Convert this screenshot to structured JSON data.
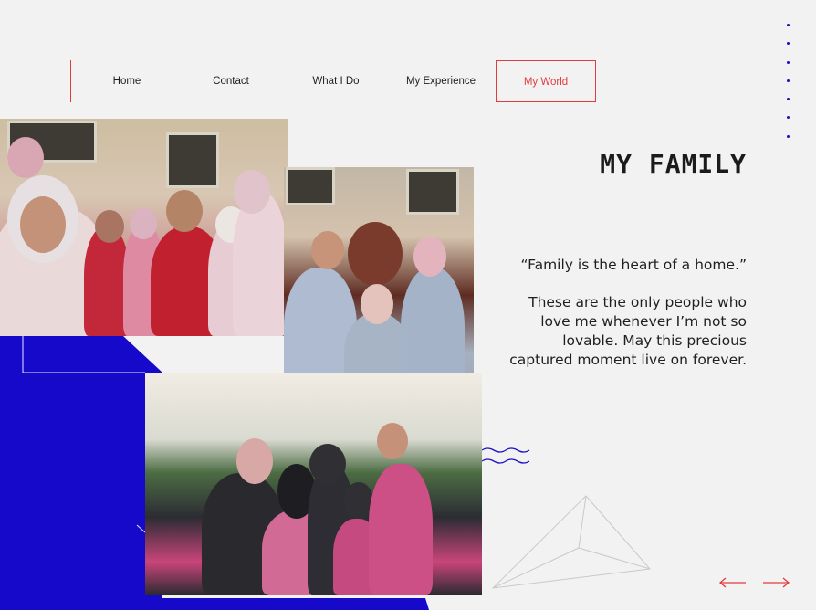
{
  "nav": {
    "items": [
      {
        "label": "Home"
      },
      {
        "label": "Contact"
      },
      {
        "label": "What I Do"
      },
      {
        "label": "My Experience"
      },
      {
        "label": "My World"
      }
    ],
    "active_index": 4
  },
  "section": {
    "title": "MY FAMILY",
    "quote": "“Family is the heart of a home.”",
    "body": "These are the only people who love me whenever I’m not so lovable. May this precious captured moment live on forever."
  },
  "photos": [
    {
      "name": "family-selfie-photo"
    },
    {
      "name": "parents-daughter-photo"
    },
    {
      "name": "family-group-photo"
    }
  ],
  "icons": {
    "prev": "arrow-left-icon",
    "next": "arrow-right-icon",
    "dots": "dot-column"
  },
  "colors": {
    "accent_red": "#e23b3b",
    "accent_blue": "#1609c9",
    "background": "#f3f2f3",
    "text": "#1d1d1d"
  }
}
